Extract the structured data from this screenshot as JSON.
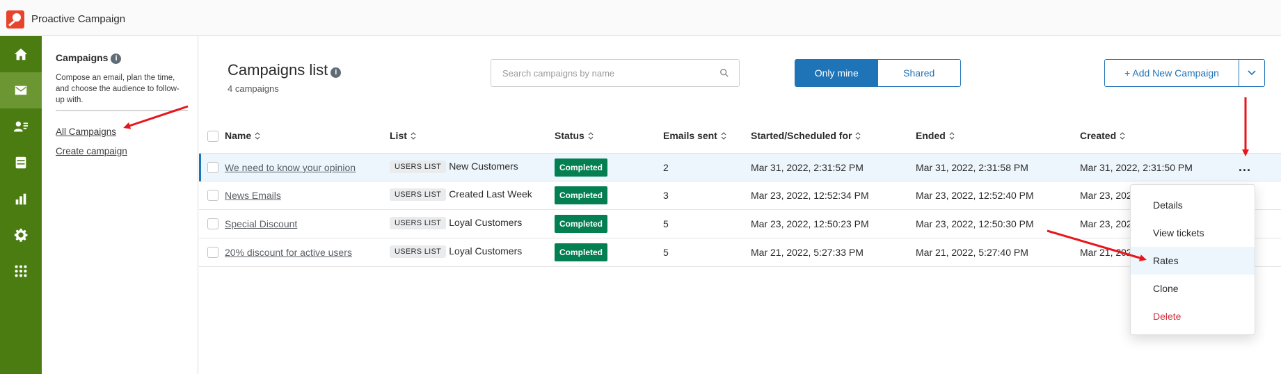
{
  "app": {
    "title": "Proactive Campaign"
  },
  "rail": {
    "items": [
      {
        "icon": "home-icon"
      },
      {
        "icon": "mail-icon",
        "active": true
      },
      {
        "icon": "contacts-icon"
      },
      {
        "icon": "database-icon"
      },
      {
        "icon": "bar-chart-icon"
      },
      {
        "icon": "gear-icon"
      },
      {
        "icon": "apps-grid-icon"
      }
    ]
  },
  "sidebar": {
    "title": "Campaigns",
    "info": "i",
    "description": "Compose an email, plan the time, and choose the audience to follow-up with.",
    "links": [
      {
        "label": "All Campaigns"
      },
      {
        "label": "Create campaign"
      }
    ]
  },
  "main": {
    "title": "Campaigns list",
    "count": "4 campaigns",
    "search_placeholder": "Search campaigns by name",
    "segment": {
      "only_mine": "Only mine",
      "shared": "Shared",
      "selected": "Only mine"
    },
    "add_button": "+ Add New Campaign"
  },
  "table": {
    "columns": [
      "Name",
      "List",
      "Status",
      "Emails sent",
      "Started/Scheduled for",
      "Ended",
      "Created"
    ],
    "rows": [
      {
        "name": "We need to know your opinion",
        "list_tag": "USERS LIST",
        "list": "New Customers",
        "status": "Completed",
        "emails_sent": "2",
        "started": "Mar 31, 2022, 2:31:52 PM",
        "ended": "Mar 31, 2022, 2:31:58 PM",
        "created": "Mar 31, 2022, 2:31:50 PM",
        "actions": "..."
      },
      {
        "name": "News Emails",
        "list_tag": "USERS LIST",
        "list": "Created Last Week",
        "status": "Completed",
        "emails_sent": "3",
        "started": "Mar 23, 2022, 12:52:34 PM",
        "ended": "Mar 23, 2022, 12:52:40 PM",
        "created": "Mar 23, 2022"
      },
      {
        "name": "Special Discount",
        "list_tag": "USERS LIST",
        "list": "Loyal Customers",
        "status": "Completed",
        "emails_sent": "5",
        "started": "Mar 23, 2022, 12:50:23 PM",
        "ended": "Mar 23, 2022, 12:50:30 PM",
        "created": "Mar 23, 2022"
      },
      {
        "name": "20% discount for active users",
        "list_tag": "USERS LIST",
        "list": "Loyal Customers",
        "status": "Completed",
        "emails_sent": "5",
        "started": "Mar 21, 2022, 5:27:33 PM",
        "ended": "Mar 21, 2022, 5:27:40 PM",
        "created": "Mar 21, 2022"
      }
    ]
  },
  "menu": {
    "items": [
      {
        "label": "Details"
      },
      {
        "label": "View tickets"
      },
      {
        "label": "Rates",
        "highlighted": true
      },
      {
        "label": "Clone"
      },
      {
        "label": "Delete",
        "danger": true
      }
    ]
  },
  "colors": {
    "rail_green": "#4a7c12",
    "rail_active": "#6b9632",
    "primary_blue": "#1f73b7",
    "completed_green": "#037f52",
    "delete_red": "#cc3340",
    "annotation_red": "#e8161b"
  }
}
